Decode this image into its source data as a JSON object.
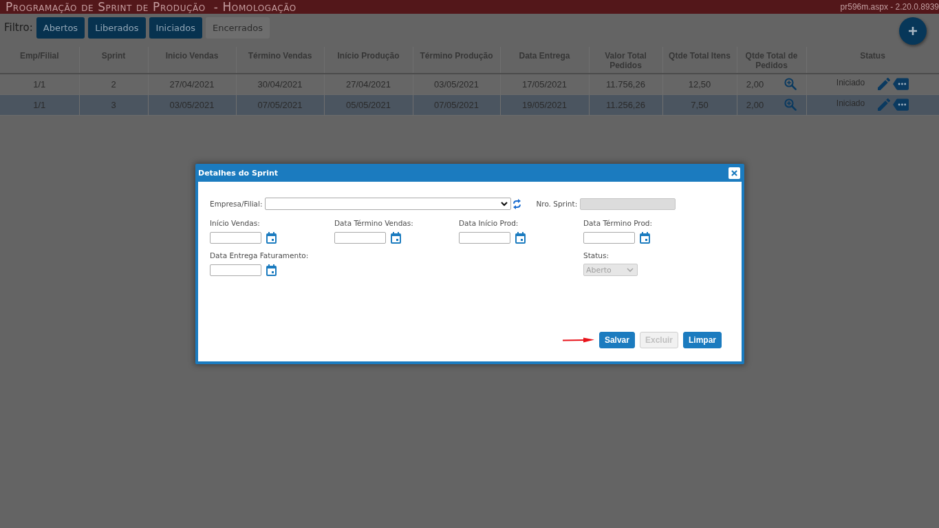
{
  "title_bar": {
    "title": "Programação de Sprint de Produção  - Homologação",
    "version": "pr596m.aspx - 2.20.0.8939"
  },
  "filter": {
    "label": "Filtro:",
    "buttons": [
      {
        "label": "Abertos",
        "selected": true
      },
      {
        "label": "Liberados",
        "selected": true
      },
      {
        "label": "Iniciados",
        "selected": true
      },
      {
        "label": "Encerrados",
        "selected": false
      }
    ]
  },
  "table": {
    "columns": [
      "Emp/Filial",
      "Sprint",
      "Inicio Vendas",
      "Término Vendas",
      "Início Produção",
      "Término Produção",
      "Data Entrega",
      "Valor Total Pedidos",
      "Qtde Total Itens",
      "Qtde Total de Pedidos",
      "Status"
    ],
    "rows": [
      {
        "selected": false,
        "cells": [
          "1/1",
          "2",
          "27/04/2021",
          "30/04/2021",
          "27/04/2021",
          "03/05/2021",
          "17/05/2021",
          "11.756,26",
          "12,50",
          "2,00",
          "Iniciado"
        ]
      },
      {
        "selected": true,
        "cells": [
          "1/1",
          "3",
          "03/05/2021",
          "07/05/2021",
          "05/05/2021",
          "07/05/2021",
          "19/05/2021",
          "11.256,26",
          "7,50",
          "2,00",
          "Iniciado"
        ]
      }
    ]
  },
  "dialog": {
    "title": "Detalhes do Sprint",
    "company": {
      "label": "Empresa/Filial:"
    },
    "sprint_number": {
      "label": "Nro. Sprint:",
      "disabled": true
    },
    "fields": [
      {
        "kind": "date",
        "label": "Início Vendas:"
      },
      {
        "kind": "date",
        "label": "Data Término Vendas:"
      },
      {
        "kind": "date",
        "label": "Data Início Prod:"
      },
      {
        "kind": "date",
        "label": "Data Término Prod:"
      },
      {
        "kind": "date",
        "label": "Data Entrega Faturamento:"
      },
      {
        "kind": "select",
        "label": "Status:",
        "value": "Aberto",
        "disabled": true
      }
    ],
    "buttons": [
      {
        "label": "Salvar",
        "disabled": false
      },
      {
        "label": "Excluir",
        "disabled": true
      },
      {
        "label": "Limpar",
        "disabled": false
      }
    ]
  }
}
